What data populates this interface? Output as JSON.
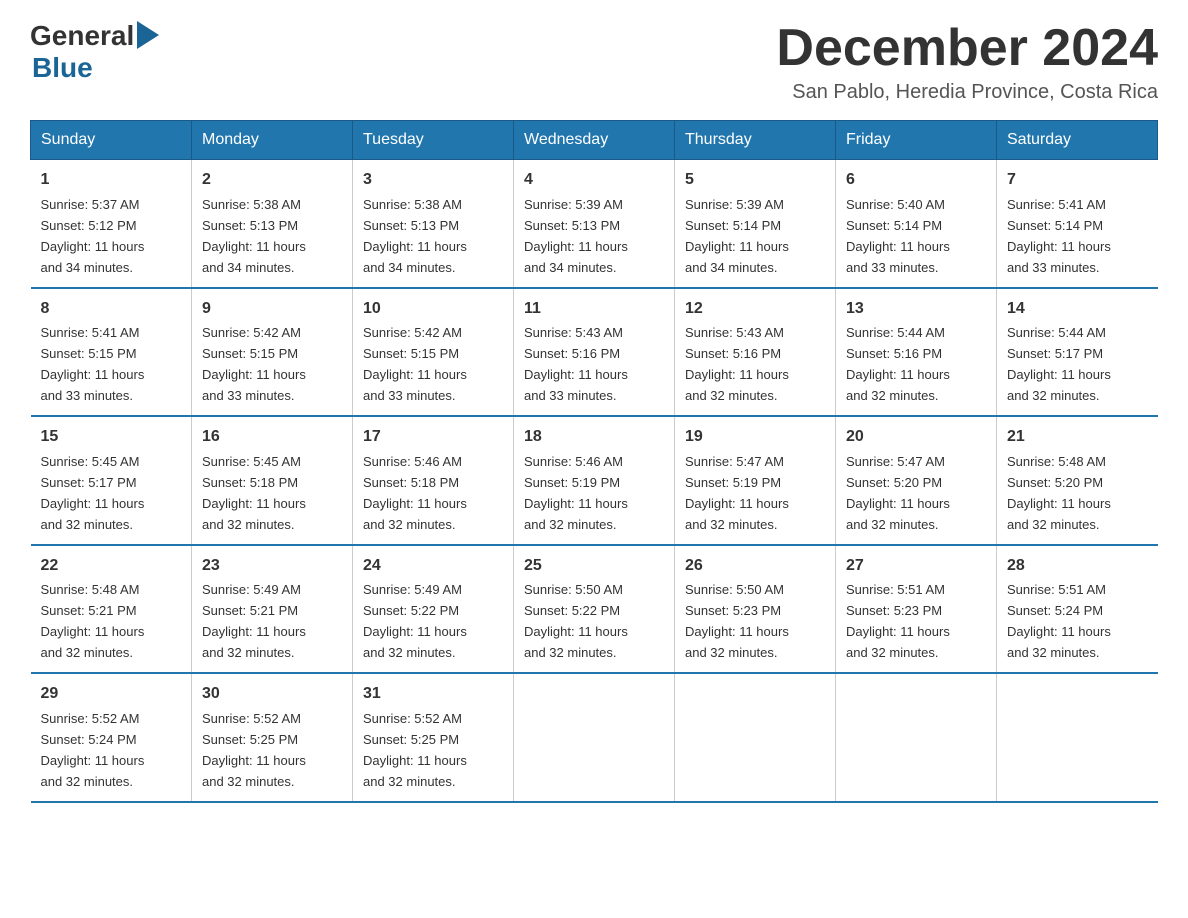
{
  "header": {
    "logo_general": "General",
    "logo_blue": "Blue",
    "month_title": "December 2024",
    "location": "San Pablo, Heredia Province, Costa Rica"
  },
  "days_of_week": [
    "Sunday",
    "Monday",
    "Tuesday",
    "Wednesday",
    "Thursday",
    "Friday",
    "Saturday"
  ],
  "weeks": [
    [
      {
        "day": "1",
        "sunrise": "5:37 AM",
        "sunset": "5:12 PM",
        "daylight": "11 hours and 34 minutes."
      },
      {
        "day": "2",
        "sunrise": "5:38 AM",
        "sunset": "5:13 PM",
        "daylight": "11 hours and 34 minutes."
      },
      {
        "day": "3",
        "sunrise": "5:38 AM",
        "sunset": "5:13 PM",
        "daylight": "11 hours and 34 minutes."
      },
      {
        "day": "4",
        "sunrise": "5:39 AM",
        "sunset": "5:13 PM",
        "daylight": "11 hours and 34 minutes."
      },
      {
        "day": "5",
        "sunrise": "5:39 AM",
        "sunset": "5:14 PM",
        "daylight": "11 hours and 34 minutes."
      },
      {
        "day": "6",
        "sunrise": "5:40 AM",
        "sunset": "5:14 PM",
        "daylight": "11 hours and 33 minutes."
      },
      {
        "day": "7",
        "sunrise": "5:41 AM",
        "sunset": "5:14 PM",
        "daylight": "11 hours and 33 minutes."
      }
    ],
    [
      {
        "day": "8",
        "sunrise": "5:41 AM",
        "sunset": "5:15 PM",
        "daylight": "11 hours and 33 minutes."
      },
      {
        "day": "9",
        "sunrise": "5:42 AM",
        "sunset": "5:15 PM",
        "daylight": "11 hours and 33 minutes."
      },
      {
        "day": "10",
        "sunrise": "5:42 AM",
        "sunset": "5:15 PM",
        "daylight": "11 hours and 33 minutes."
      },
      {
        "day": "11",
        "sunrise": "5:43 AM",
        "sunset": "5:16 PM",
        "daylight": "11 hours and 33 minutes."
      },
      {
        "day": "12",
        "sunrise": "5:43 AM",
        "sunset": "5:16 PM",
        "daylight": "11 hours and 32 minutes."
      },
      {
        "day": "13",
        "sunrise": "5:44 AM",
        "sunset": "5:16 PM",
        "daylight": "11 hours and 32 minutes."
      },
      {
        "day": "14",
        "sunrise": "5:44 AM",
        "sunset": "5:17 PM",
        "daylight": "11 hours and 32 minutes."
      }
    ],
    [
      {
        "day": "15",
        "sunrise": "5:45 AM",
        "sunset": "5:17 PM",
        "daylight": "11 hours and 32 minutes."
      },
      {
        "day": "16",
        "sunrise": "5:45 AM",
        "sunset": "5:18 PM",
        "daylight": "11 hours and 32 minutes."
      },
      {
        "day": "17",
        "sunrise": "5:46 AM",
        "sunset": "5:18 PM",
        "daylight": "11 hours and 32 minutes."
      },
      {
        "day": "18",
        "sunrise": "5:46 AM",
        "sunset": "5:19 PM",
        "daylight": "11 hours and 32 minutes."
      },
      {
        "day": "19",
        "sunrise": "5:47 AM",
        "sunset": "5:19 PM",
        "daylight": "11 hours and 32 minutes."
      },
      {
        "day": "20",
        "sunrise": "5:47 AM",
        "sunset": "5:20 PM",
        "daylight": "11 hours and 32 minutes."
      },
      {
        "day": "21",
        "sunrise": "5:48 AM",
        "sunset": "5:20 PM",
        "daylight": "11 hours and 32 minutes."
      }
    ],
    [
      {
        "day": "22",
        "sunrise": "5:48 AM",
        "sunset": "5:21 PM",
        "daylight": "11 hours and 32 minutes."
      },
      {
        "day": "23",
        "sunrise": "5:49 AM",
        "sunset": "5:21 PM",
        "daylight": "11 hours and 32 minutes."
      },
      {
        "day": "24",
        "sunrise": "5:49 AM",
        "sunset": "5:22 PM",
        "daylight": "11 hours and 32 minutes."
      },
      {
        "day": "25",
        "sunrise": "5:50 AM",
        "sunset": "5:22 PM",
        "daylight": "11 hours and 32 minutes."
      },
      {
        "day": "26",
        "sunrise": "5:50 AM",
        "sunset": "5:23 PM",
        "daylight": "11 hours and 32 minutes."
      },
      {
        "day": "27",
        "sunrise": "5:51 AM",
        "sunset": "5:23 PM",
        "daylight": "11 hours and 32 minutes."
      },
      {
        "day": "28",
        "sunrise": "5:51 AM",
        "sunset": "5:24 PM",
        "daylight": "11 hours and 32 minutes."
      }
    ],
    [
      {
        "day": "29",
        "sunrise": "5:52 AM",
        "sunset": "5:24 PM",
        "daylight": "11 hours and 32 minutes."
      },
      {
        "day": "30",
        "sunrise": "5:52 AM",
        "sunset": "5:25 PM",
        "daylight": "11 hours and 32 minutes."
      },
      {
        "day": "31",
        "sunrise": "5:52 AM",
        "sunset": "5:25 PM",
        "daylight": "11 hours and 32 minutes."
      },
      null,
      null,
      null,
      null
    ]
  ],
  "labels": {
    "sunrise": "Sunrise:",
    "sunset": "Sunset:",
    "daylight": "Daylight:"
  }
}
